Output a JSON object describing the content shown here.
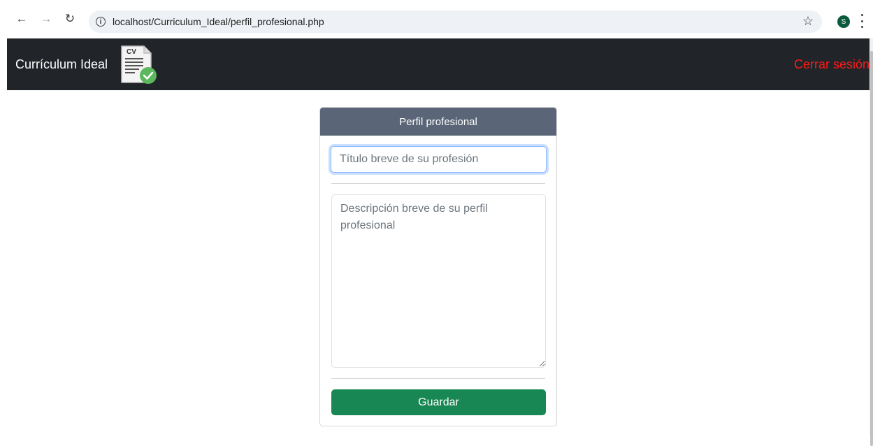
{
  "browser": {
    "url": "localhost/Curriculum_Ideal/perfil_profesional.php",
    "back_icon": "←",
    "forward_icon": "→",
    "reload_icon": "↻",
    "star_icon": "☆",
    "profile_initial": "S"
  },
  "navbar": {
    "brand": "Currículum Ideal",
    "logo_text": "CV",
    "logout": "Cerrar sesión"
  },
  "card": {
    "header": "Perfil profesional",
    "title_placeholder": "Título breve de su profesión",
    "description_placeholder": "Descripción breve de su perfil profesional",
    "save_label": "Guardar"
  },
  "colors": {
    "navbar_bg": "#212529",
    "logout": "#ff1a1a",
    "card_header": "#5a6678",
    "save_button": "#198754",
    "avatar": "#0b5a3c"
  }
}
